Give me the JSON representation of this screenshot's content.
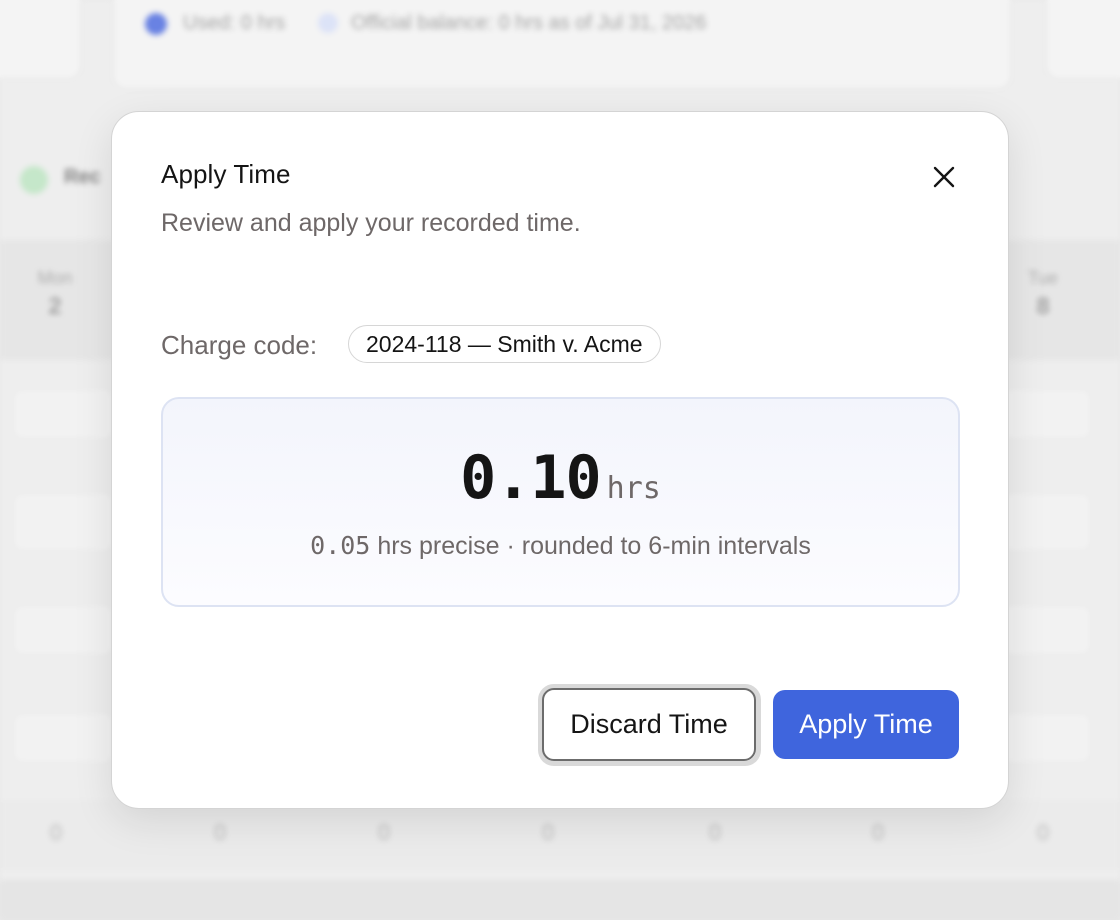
{
  "background": {
    "legend": {
      "used_label": "Used: 0 hrs",
      "balance_label": "Official balance: 0 hrs as of Jul 31, 2026"
    },
    "section_label": "Rec",
    "days": [
      {
        "name": "Mon",
        "num": "2"
      },
      {
        "name": "Tue",
        "num": "8"
      }
    ],
    "row_values": [
      "0",
      "0",
      "0",
      "0",
      "0",
      "0",
      "0"
    ]
  },
  "modal": {
    "title": "Apply Time",
    "subtitle": "Review and apply your recorded time.",
    "close_icon": "close-icon",
    "charge_label": "Charge code:",
    "charge_code": "2024-118 — Smith v. Acme",
    "time_value": "0.10",
    "time_unit": "hrs",
    "precise_value": "0.05",
    "precise_text": "hrs precise · rounded to 6-min intervals",
    "discard_label": "Discard Time",
    "apply_label": "Apply Time"
  },
  "colors": {
    "primary": "#3f65dd",
    "muted_text": "#6e6868",
    "highlight_border": "#dde3f3"
  }
}
